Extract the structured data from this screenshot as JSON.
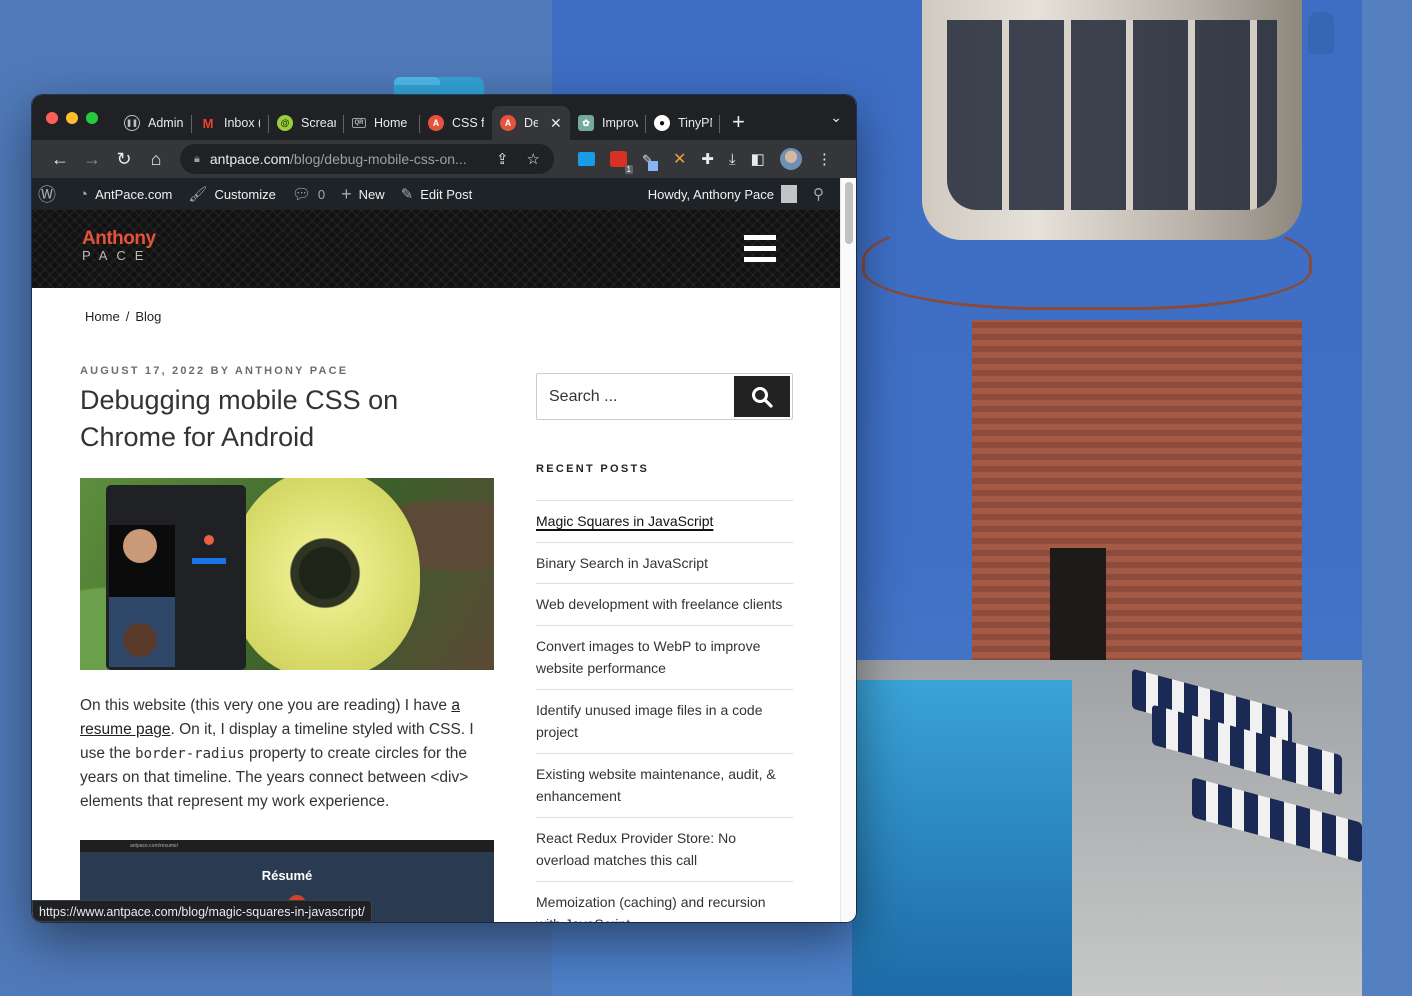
{
  "browser": {
    "tabs": [
      {
        "label": "Admin",
        "icon": "pause-circle-icon"
      },
      {
        "label": "Inbox (",
        "icon": "gmail-icon"
      },
      {
        "label": "Screar",
        "icon": "screaming-frog-icon"
      },
      {
        "label": "Home",
        "icon": "qr-icon"
      },
      {
        "label": "CSS fc",
        "icon": "antpace-a-icon"
      },
      {
        "label": "De",
        "icon": "antpace-a-icon",
        "active": true
      },
      {
        "label": "Improv",
        "icon": "openai-icon"
      },
      {
        "label": "TinyPN",
        "icon": "tinypng-panda-icon"
      }
    ],
    "new_tab": "+",
    "tab_search": "⌄",
    "url_host": "antpace.com",
    "url_path": "/blog/debug-mobile-css-on...",
    "extension_badge": "1",
    "status_url": "https://www.antpace.com/blog/magic-squares-in-javascript/"
  },
  "adminbar": {
    "site": "AntPace.com",
    "customize": "Customize",
    "comments": "0",
    "new": "New",
    "edit": "Edit Post",
    "howdy": "Howdy, Anthony Pace"
  },
  "site": {
    "logo_top": "Anthony",
    "logo_bottom": "PACE",
    "breadcrumb": [
      "Home",
      "Blog"
    ],
    "breadcrumb_sep": "/"
  },
  "post": {
    "meta": "AUGUST 17, 2022 BY ANTHONY PACE",
    "title": "Debugging mobile CSS on Chrome for Android",
    "para_1": "On this website (this very one you are reading) I have ",
    "link_text": "a resume page",
    "para_2": ". On it, I display a timeline styled with CSS. I use the ",
    "code": "border-radius",
    "para_3": " property to create circles for the years on that timeline. The years connect between <div> elements that represent my work experience.",
    "inline_image_heading": "Résumé",
    "inline_image_url": "antpace.com/resume/"
  },
  "sidebar": {
    "search_placeholder": "Search ...",
    "recent_title": "RECENT POSTS",
    "recent_posts": [
      "Magic Squares in JavaScript",
      "Binary Search in JavaScript",
      "Web development with freelance clients",
      "Convert images to WebP to improve website performance",
      "Identify unused image files in a code project",
      "Existing website maintenance, audit, & enhancement",
      "React Redux Provider Store: No overload matches this call",
      "Memoization (caching) and recursion with JavaScript"
    ]
  },
  "colors": {
    "desktop": "#4f79b8",
    "tabbar": "#202124",
    "toolbar": "#35363a",
    "adminbar": "#1d2327",
    "logo_accent": "#e5533b"
  }
}
